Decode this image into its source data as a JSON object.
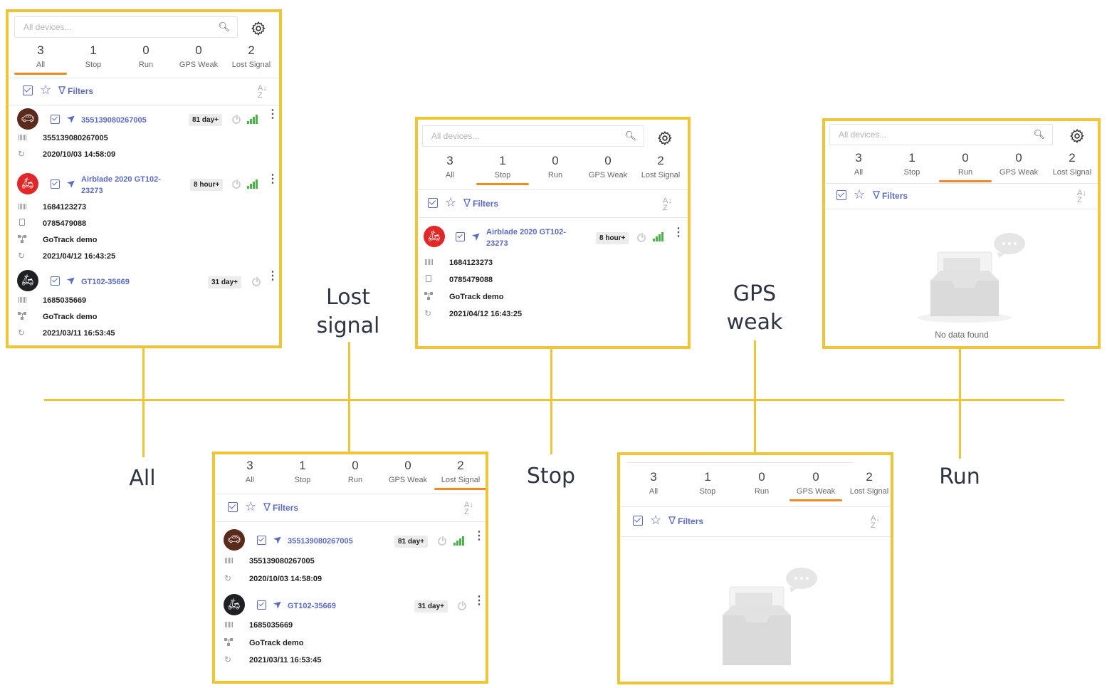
{
  "captions": {
    "all": "All",
    "lost_signal": [
      "Lost",
      "signal"
    ],
    "stop": "Stop",
    "gps_weak": [
      "GPS",
      "weak"
    ],
    "run": "Run"
  },
  "colors": {
    "frame": "#efc435",
    "accent": "#5b6ac4",
    "tab_underline": "#ef8a20",
    "signal": "#4bb34b"
  },
  "search_placeholder": "All devices...",
  "tabs": [
    {
      "count": "3",
      "label": "All"
    },
    {
      "count": "1",
      "label": "Stop"
    },
    {
      "count": "0",
      "label": "Run"
    },
    {
      "count": "0",
      "label": "GPS Weak"
    },
    {
      "count": "2",
      "label": "Lost Signal"
    }
  ],
  "toolbar": {
    "filters_label": "Filters",
    "sort_label": "A Z"
  },
  "devices": {
    "d1": {
      "name": "355139080267005",
      "badge": "81 day+",
      "imei": "355139080267005",
      "updated": "2020/10/03 14:58:09",
      "icon": "car-icon"
    },
    "d2": {
      "name": "Airblade 2020 GT102-23273",
      "name_line1": "Airblade 2020 GT102-",
      "name_line2": "23273",
      "badge": "8 hour+",
      "imei": "1684123273",
      "phone": "0785479088",
      "group": "GoTrack demo",
      "updated": "2021/04/12 16:43:25",
      "icon": "scooter-icon"
    },
    "d3": {
      "name": "GT102-35669",
      "badge": "31 day+",
      "imei": "1685035669",
      "group": "GoTrack demo",
      "updated": "2021/03/11 16:53:45",
      "icon": "scooter-icon"
    }
  },
  "empty_text": "No data found",
  "icons": [
    "search-icon",
    "gear-icon",
    "checkbox-icon",
    "star-icon",
    "filter-icon",
    "sort-icon",
    "navigate-icon",
    "power-icon",
    "signal-icon",
    "more-icon",
    "barcode-icon",
    "sim-icon",
    "group-icon",
    "refresh-icon",
    "empty-inbox-icon"
  ]
}
